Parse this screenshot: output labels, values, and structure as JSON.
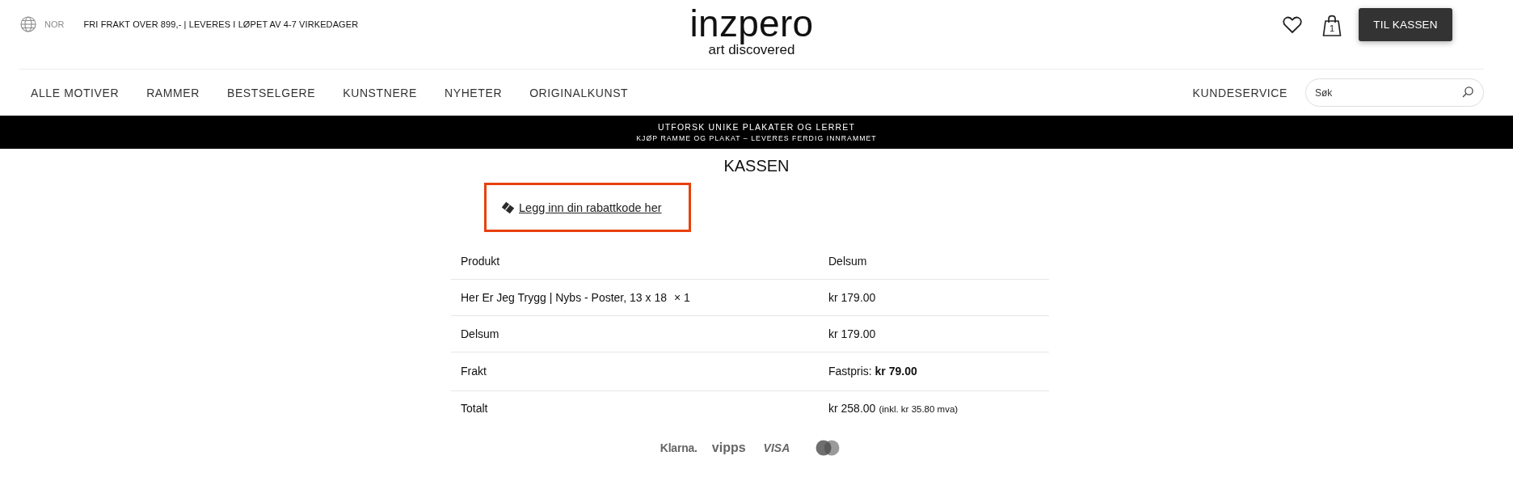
{
  "top_bar": {
    "region": "NOR",
    "notice": "FRI FRAKT OVER 899,- | LEVERES I LØPET AV 4-7 VIRKEDAGER",
    "logo": {
      "wordmark": "inzpero",
      "tagline": "art discovered"
    },
    "cart_count": "1",
    "checkout_button": "TIL KASSEN"
  },
  "nav": {
    "items": [
      {
        "label": "ALLE MOTIVER"
      },
      {
        "label": "RAMMER"
      },
      {
        "label": "BESTSELGERE"
      },
      {
        "label": "KUNSTNERE"
      },
      {
        "label": "NYHETER"
      },
      {
        "label": "ORIGINALKUNST"
      }
    ],
    "customer_service": "KUNDESERVICE",
    "search": {
      "placeholder": "Søk"
    }
  },
  "banner": {
    "headline": "UTFORSK UNIKE PLAKATER OG LERRET",
    "subline": "KJØP RAMME OG PLAKAT – LEVERES FERDIG INNRAMMET"
  },
  "checkout": {
    "title": "KASSEN",
    "coupon": {
      "label": "Legg inn din rabattkode her",
      "highlighted": true
    },
    "table": {
      "columns": [
        "Produkt",
        "Delsum"
      ],
      "rows": [
        {
          "label": "Her Er Jeg Trygg | Nybs - Poster, 13 x 18",
          "quantity": "× 1",
          "value": "kr 179.00"
        },
        {
          "label": "Delsum",
          "value": "kr 179.00"
        },
        {
          "label": "Frakt",
          "value": "Fastpris: **kr 79.00**"
        },
        {
          "label": "Totalt",
          "value": "kr 258.00",
          "note": "(inkl. kr 35.80 mva)"
        }
      ]
    }
  },
  "payment_methods": [
    {
      "kind": "klarna",
      "label": "Klarna."
    },
    {
      "kind": "vipps",
      "label": "vipps"
    },
    {
      "kind": "visa",
      "label": "VISA"
    },
    {
      "kind": "mastercard"
    }
  ]
}
